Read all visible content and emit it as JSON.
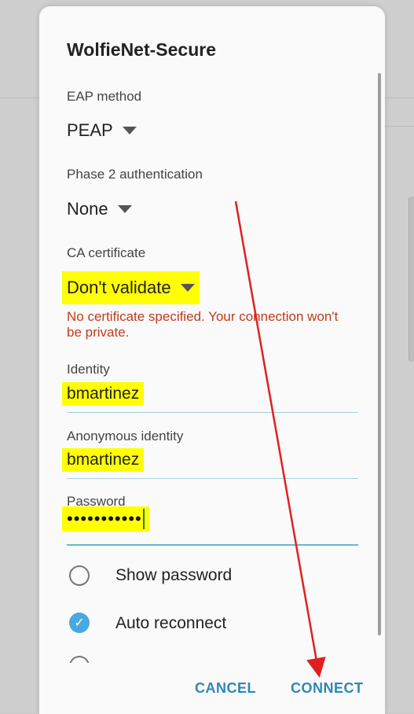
{
  "dialog": {
    "title": "WolfieNet-Secure",
    "eap_method": {
      "label": "EAP method",
      "value": "PEAP"
    },
    "phase2": {
      "label": "Phase 2 authentication",
      "value": "None"
    },
    "ca_certificate": {
      "label": "CA certificate",
      "value": "Don't validate",
      "warning": "No certificate specified. Your connection won't be private."
    },
    "identity": {
      "label": "Identity",
      "value": "bmartinez"
    },
    "anonymous_identity": {
      "label": "Anonymous identity",
      "value": "bmartinez"
    },
    "password": {
      "label": "Password",
      "value": "•••••••••••"
    },
    "options": {
      "show_password": {
        "label": "Show password",
        "checked": false
      },
      "auto_reconnect": {
        "label": "Auto reconnect",
        "checked": true
      }
    },
    "actions": {
      "cancel": "CANCEL",
      "connect": "CONNECT"
    }
  },
  "colors": {
    "accent": "#2d88b5",
    "highlight": "#ffff00",
    "warning": "#c23a1a",
    "annotation_arrow": "#e02020"
  }
}
